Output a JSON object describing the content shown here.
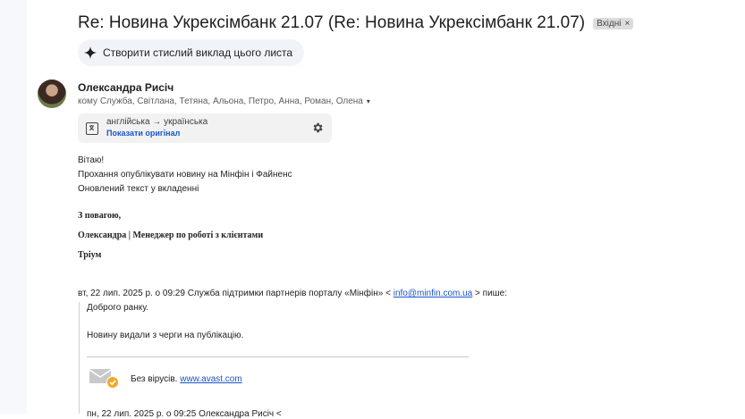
{
  "subject": {
    "title": "Re: Новина Укрексімбанк 21.07 (Re: Новина Укрексімбанк 21.07)",
    "label": "Вхідні",
    "label_close": "×"
  },
  "summary_button": {
    "label": "Створити стислий виклад цього листа",
    "icon": "sparkle-icon"
  },
  "message": {
    "sender": "Олександра Рисіч",
    "recipients": "кому Служба, Світлана, Тетяна, Альона, Петро, Анна, Роман, Олена",
    "recipients_caret": "▾",
    "translation": {
      "languages": "англійська → українська",
      "show_original": "Показати оригінал",
      "settings_icon": "gear-icon"
    },
    "body_lines": [
      "Вітаю!",
      "Прохання опублікувати новину на Мінфін і Файненс",
      "Оновлений текст у вкладенні"
    ],
    "signature": [
      "З повагою,",
      "Олександра | Менеджер по роботі з клієнтами",
      "Тріум"
    ]
  },
  "quoted": {
    "header_prefix": "вт, 22 лип. 2025 р. о 09:29 Служба підтримки партнерів порталу «Мінфін» <",
    "header_email": "info@minfin.com.ua",
    "header_suffix": "> пише:",
    "lines": [
      "Доброго ранку.",
      "Новину видали з черги на публікацію."
    ],
    "avast_text": "Без вірусів.",
    "avast_link": "www.avast.com",
    "cut_line": "пн, 22 лип. 2025 р. о 09:25 Олександра Рисіч <"
  },
  "colors": {
    "link": "#1a56c4",
    "avast_badge": "#f5a623",
    "chip_bg": "#dddddd",
    "summary_bg": "#f0f4f9",
    "translate_bg": "#f2f2f2"
  }
}
